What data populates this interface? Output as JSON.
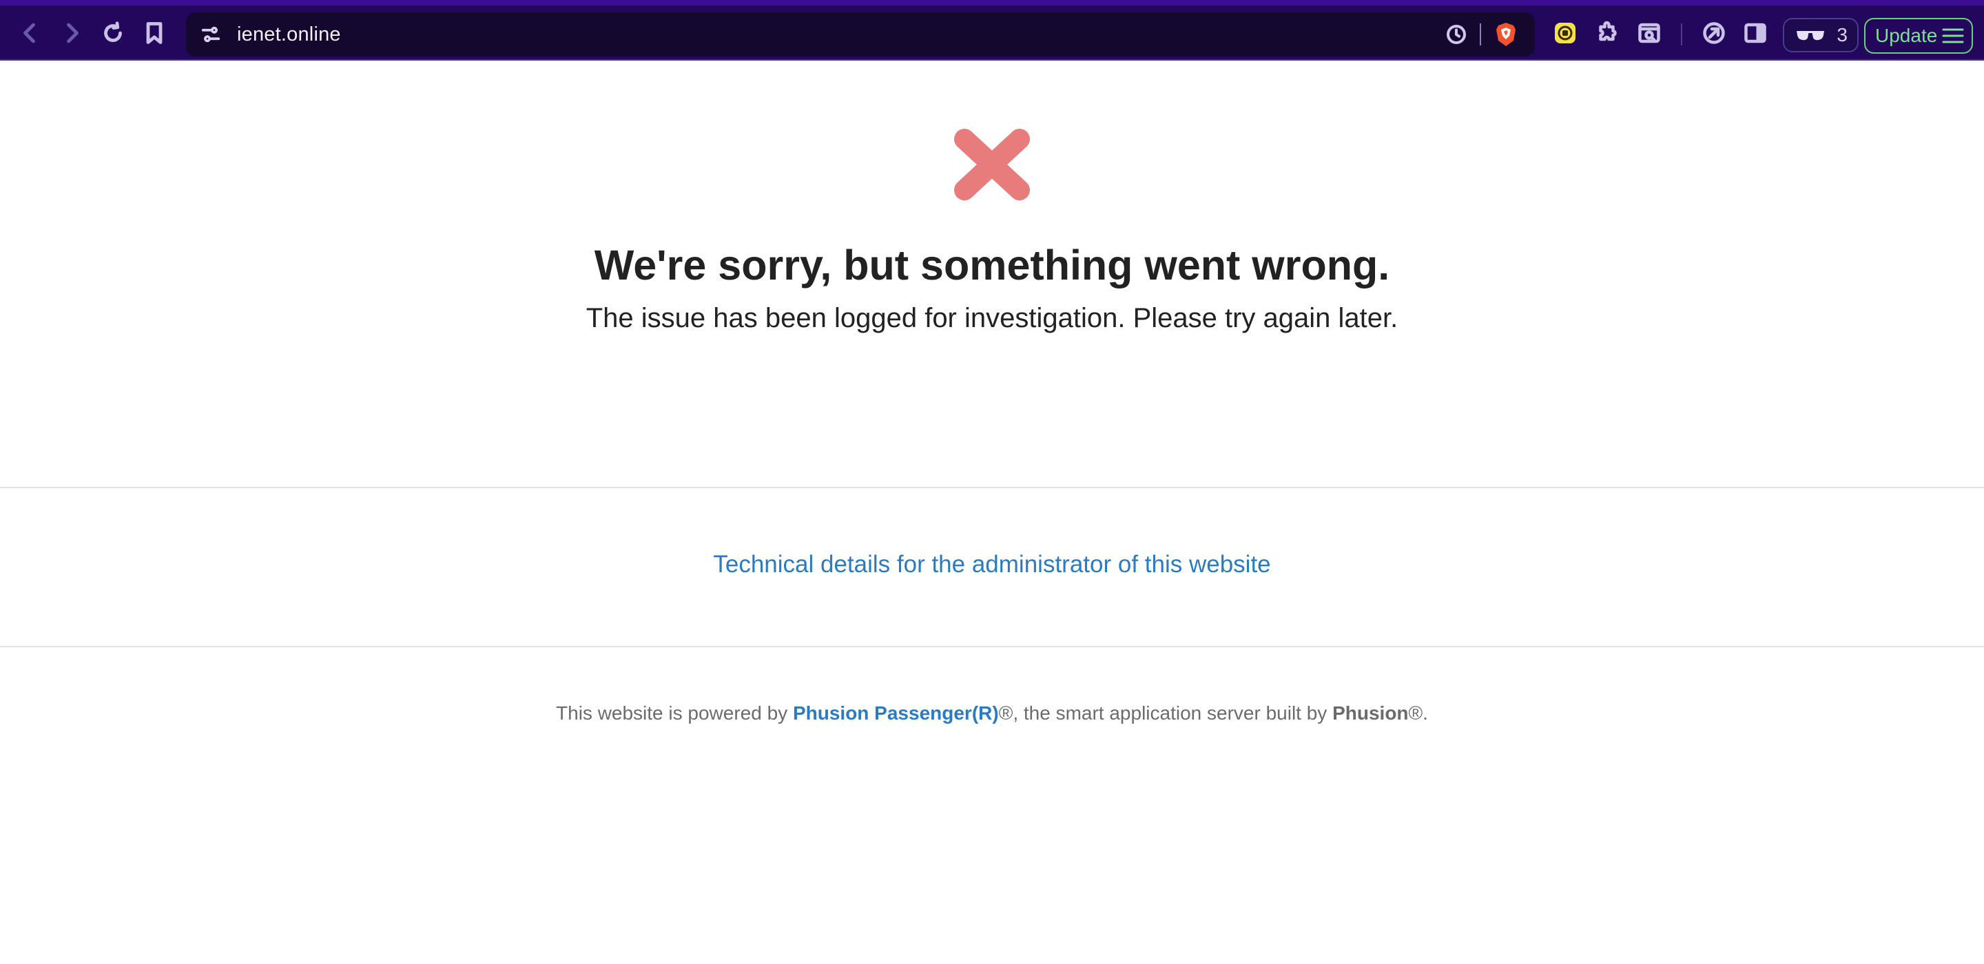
{
  "browser": {
    "url": "ienet.online",
    "vpn_count": "3",
    "update_label": "Update",
    "colors": {
      "toolbar": "#22075c",
      "urlbar": "#14082e",
      "update_accent": "#69d17c"
    },
    "icons": [
      "back-icon",
      "forward-icon",
      "reload-icon",
      "bookmark-icon",
      "site-settings-icon",
      "history-icon",
      "brave-shield-icon",
      "rewards-extension-icon",
      "extensions-puzzle-icon",
      "tab-search-icon",
      "leo-ai-icon",
      "sidebar-icon",
      "glasses-icon",
      "hamburger-menu-icon"
    ]
  },
  "page": {
    "heading": "We're sorry, but something went wrong.",
    "subheading": "The issue has been logged for investigation. Please try again later.",
    "tech_link": "Technical details for the administrator of this website",
    "footer": {
      "prefix": "This website is powered by ",
      "product": "Phusion Passenger(R)",
      "middle": "®, the smart application server built by ",
      "company": "Phusion",
      "suffix": "®."
    },
    "colors": {
      "error_icon": "#e87b7b",
      "link": "#2a7bbf",
      "heading": "#222222"
    }
  }
}
